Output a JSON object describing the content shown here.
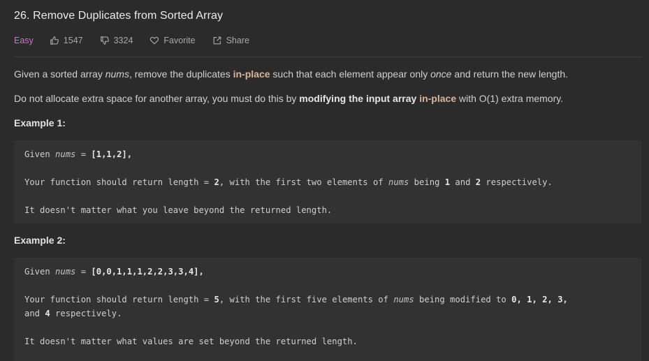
{
  "problem": {
    "title": "26. Remove Duplicates from Sorted Array",
    "difficulty": "Easy",
    "likes": "1547",
    "dislikes": "3324",
    "favorite_label": "Favorite",
    "share_label": "Share"
  },
  "description": {
    "p1": {
      "a": "Given a sorted array ",
      "b": "nums",
      "c": ", remove the duplicates ",
      "d": "in-place",
      "e": " such that each element appear only ",
      "f": "once",
      "g": " and return the new length."
    },
    "p2": {
      "a": "Do not allocate extra space for another array, you must do this by ",
      "b": "modifying the input array",
      "c": " ",
      "d": "in-place",
      "e": " with O(1) extra memory."
    }
  },
  "example1": {
    "heading": "Example 1:",
    "l1": {
      "a": "Given ",
      "b": "nums",
      "c": " = ",
      "d": "[1,1,2]",
      "e": ","
    },
    "l2": {
      "a": "Your function should return length = ",
      "b": "2",
      "c": ", with the first two elements of ",
      "d": "nums",
      "e": " being ",
      "f": "1",
      "g": " and ",
      "h": "2",
      "i": " respectively."
    },
    "l3": "It doesn't matter what you leave beyond the returned length."
  },
  "example2": {
    "heading": "Example 2:",
    "l1": {
      "a": "Given ",
      "b": "nums",
      "c": " = ",
      "d": "[0,0,1,1,1,2,2,3,3,4]",
      "e": ","
    },
    "l2": {
      "a": "Your function should return length = ",
      "b": "5",
      "c": ", with the first five elements of ",
      "d": "nums",
      "e": " being modified to ",
      "f": "0",
      "g": ", ",
      "h": "1",
      "i": ", ",
      "j": "2",
      "k": ", ",
      "l": "3",
      "m": ","
    },
    "l3": {
      "a": "and ",
      "b": "4",
      "c": " respectively."
    },
    "l4": "It doesn't matter what values are set beyond the returned length."
  },
  "colors": {
    "background": "#2b2b2b",
    "code_background": "#333232",
    "difficulty_easy": "#c976c9",
    "highlight": "#d8b59b"
  },
  "icons": {
    "like": "thumbs-up-icon",
    "dislike": "thumbs-down-icon",
    "favorite": "heart-icon",
    "share": "share-icon"
  }
}
